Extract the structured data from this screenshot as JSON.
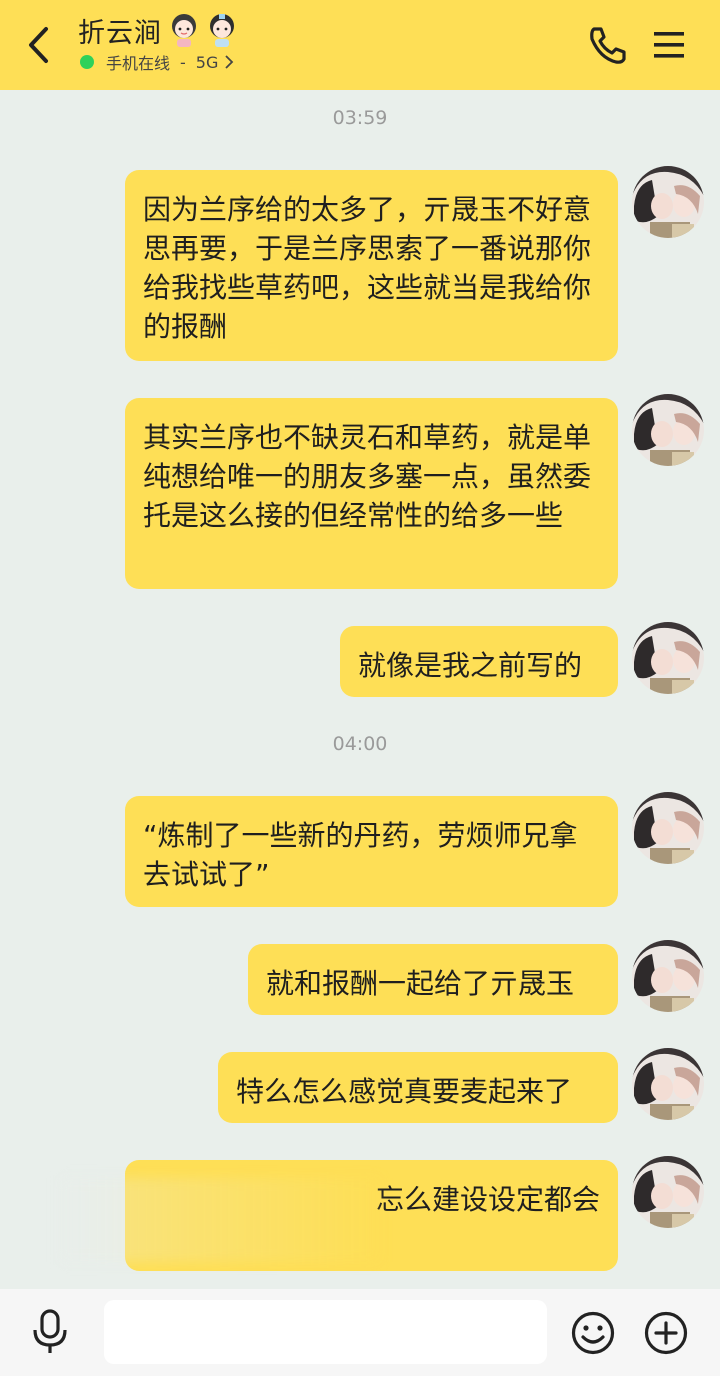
{
  "header": {
    "contact_name": "折云涧",
    "status_text": "手机在线",
    "separator": "-",
    "network": "5G"
  },
  "timestamps": [
    "03:59",
    "04:00"
  ],
  "messages": [
    {
      "text": "因为兰序给的太多了，亓晟玉不好意思再要，于是兰序思索了一番说那你给我找些草药吧，这些就当是我给你的报酬"
    },
    {
      "text": "其实兰序也不缺灵石和草药，就是单纯想给唯一的朋友多塞一点，虽然委托是这么接的但经常性的给多一些"
    },
    {
      "text": "就像是我之前写的"
    },
    {
      "text": "“炼制了一些新的丹药，劳烦师兄拿去试试了”"
    },
    {
      "text": "就和报酬一起给了亓晟玉"
    },
    {
      "text": "特么怎么感觉真要麦起来了"
    },
    {
      "text": "忘么建设设定都会"
    }
  ],
  "colors": {
    "accent_yellow": "#fedf56",
    "background": "#e9efeb",
    "online_green": "#2fd15a"
  },
  "icons": {
    "back": "back-arrow-icon",
    "phone": "phone-icon",
    "menu": "menu-icon",
    "mic": "microphone-icon",
    "emoji": "smiley-icon",
    "more": "plus-circle-icon"
  }
}
